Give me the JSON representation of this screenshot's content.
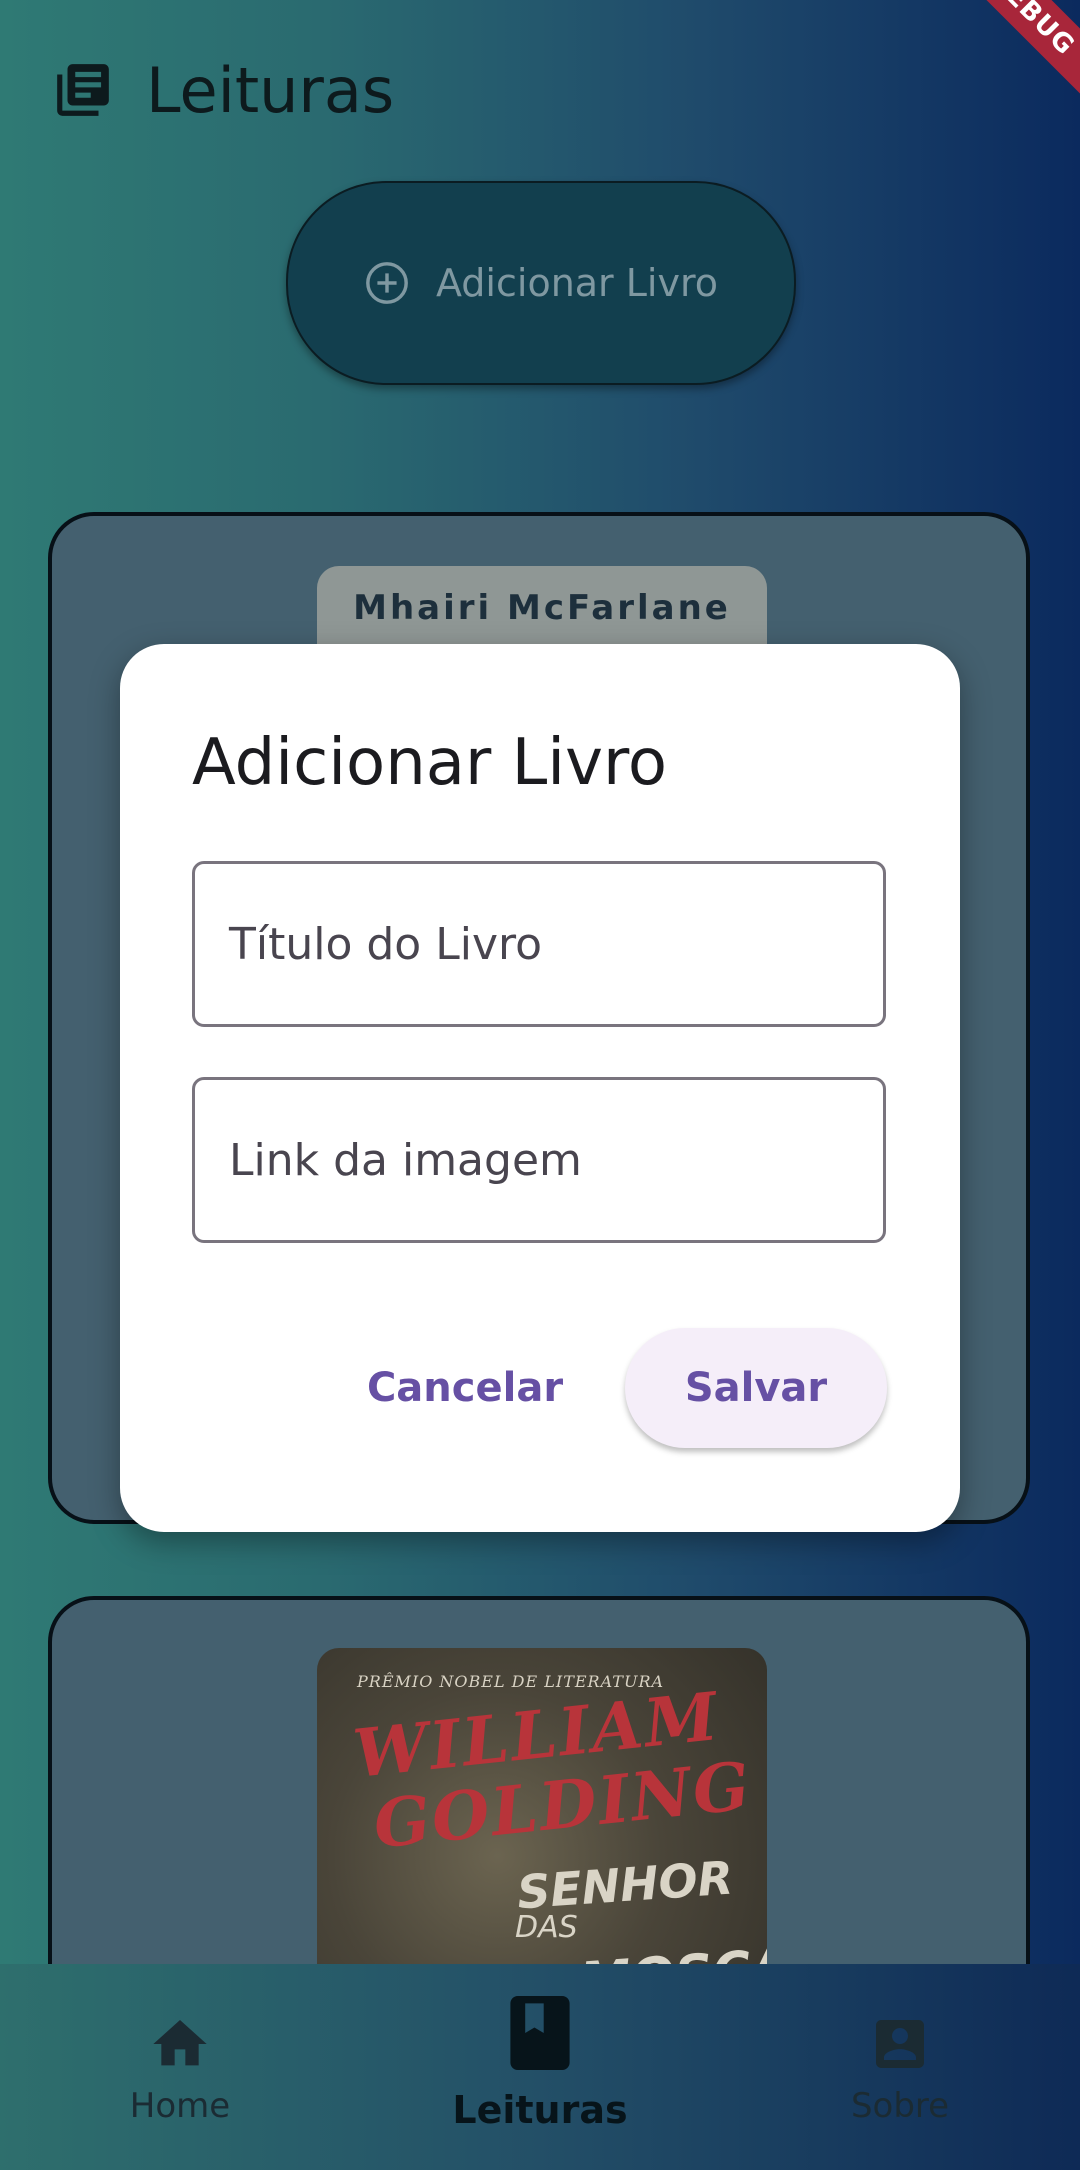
{
  "app": {
    "title": "Leituras",
    "debug_banner": "DEBUG"
  },
  "actions": {
    "add_book_button": "Adicionar Livro"
  },
  "books": [
    {
      "author_text": "Mhairi McFarlane"
    },
    {
      "cover_lines": [
        "PRÊMIO NOBEL DE LITERATURA",
        "WILLIAM",
        "GOLDING",
        "SENHOR",
        "DAS",
        "MOSCAS"
      ]
    }
  ],
  "dialog": {
    "title": "Adicionar Livro",
    "title_field_placeholder": "Título do Livro",
    "image_field_placeholder": "Link da imagem",
    "cancel_label": "Cancelar",
    "save_label": "Salvar"
  },
  "bottom_nav": {
    "items": [
      {
        "label": "Home",
        "icon": "home-icon",
        "selected": false
      },
      {
        "label": "Leituras",
        "icon": "book-icon",
        "selected": true
      },
      {
        "label": "Sobre",
        "icon": "account-box-icon",
        "selected": false
      }
    ]
  },
  "colors": {
    "accent": "#6650a4",
    "dialog_bg": "#ffffff",
    "card_bg": "#44606f",
    "debug_banner": "#a8263a"
  }
}
